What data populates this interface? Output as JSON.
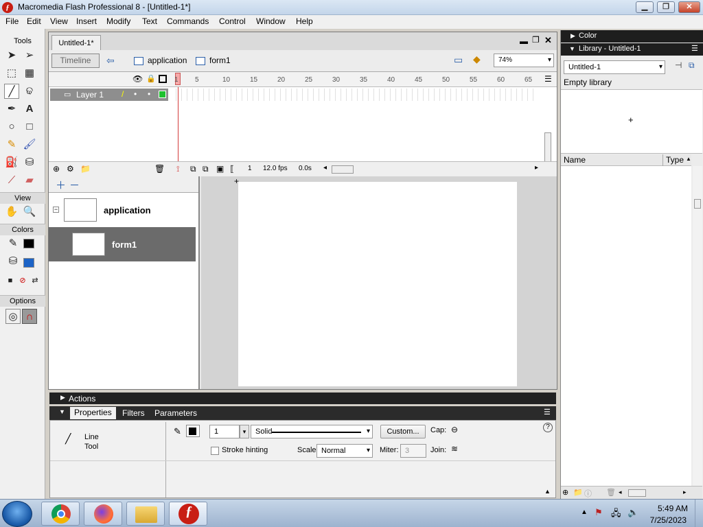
{
  "window": {
    "title": "Macromedia Flash Professional 8 - [Untitled-1*]"
  },
  "menu": [
    "File",
    "Edit",
    "View",
    "Insert",
    "Modify",
    "Text",
    "Commands",
    "Control",
    "Window",
    "Help"
  ],
  "tools": {
    "title": "Tools",
    "view_title": "View",
    "colors_title": "Colors",
    "options_title": "Options"
  },
  "document": {
    "tab": "Untitled-1*",
    "timeline_label": "Timeline",
    "breadcrumb": [
      "application",
      "form1"
    ],
    "zoom": "74%"
  },
  "timeline": {
    "layer_name": "Layer 1",
    "frame_numbers": [
      "1",
      "5",
      "10",
      "15",
      "20",
      "25",
      "30",
      "35",
      "40",
      "45",
      "50",
      "55",
      "60",
      "65"
    ],
    "current_frame": "1",
    "fps": "12.0 fps",
    "elapsed": "0.0s"
  },
  "screens": {
    "items": [
      {
        "label": "application",
        "selected": false
      },
      {
        "label": "form1",
        "selected": true
      }
    ]
  },
  "actions_panel": {
    "label": "Actions"
  },
  "properties": {
    "tabs": [
      "Properties",
      "Filters",
      "Parameters"
    ],
    "tool_name": "Line",
    "tool_kind": "Tool",
    "stroke_height": "1",
    "stroke_style": "Solid",
    "custom_button": "Custom...",
    "cap_label": "Cap:",
    "stroke_hinting_label": "Stroke hinting",
    "scale_label": "Scale:",
    "scale_value": "Normal",
    "miter_label": "Miter:",
    "miter_value": "3",
    "join_label": "Join:",
    "help_icon": "?"
  },
  "color_panel": {
    "label": "Color"
  },
  "library": {
    "title": "Library - Untitled-1",
    "doc_select": "Untitled-1",
    "status": "Empty library",
    "col_name": "Name",
    "col_type": "Type"
  },
  "taskbar": {
    "time": "5:49 AM",
    "date": "7/25/2023"
  },
  "colors": {
    "layer_active": "#8e8e8e",
    "playhead": "#d33a3a",
    "flash_red": "#c81e14"
  }
}
